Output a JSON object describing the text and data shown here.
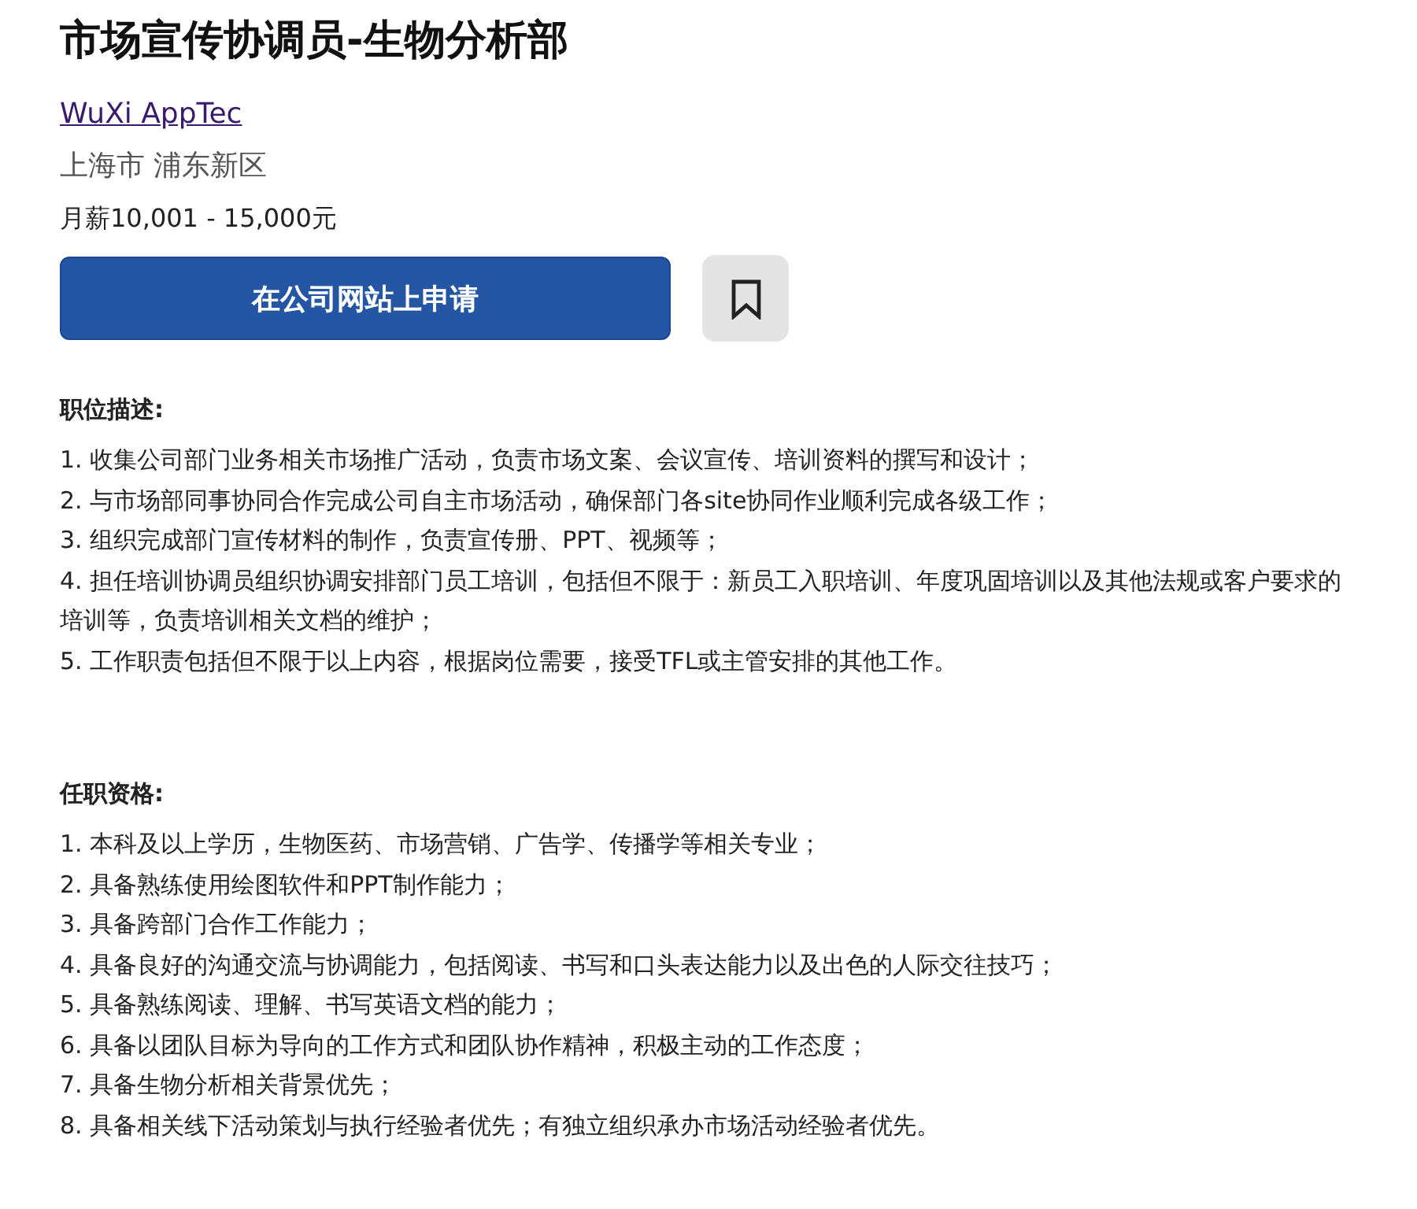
{
  "job": {
    "title": "市场宣传协调员-生物分析部",
    "company": "WuXi AppTec",
    "location": "上海市 浦东新区",
    "salary": "月薪10,001 - 15,000元"
  },
  "actions": {
    "apply": "在公司网站上申请",
    "saved": false
  },
  "sections": [
    {
      "heading": "职位描述:",
      "items": [
        "1. 收集公司部门业务相关市场推广活动，负责市场文案、会议宣传、培训资料的撰写和设计；",
        "2. 与市场部同事协同合作完成公司自主市场活动，确保部门各site协同作业顺利完成各级工作；",
        "3. 组织完成部门宣传材料的制作，负责宣传册、PPT、视频等；",
        "4. 担任培训协调员组织协调安排部门员工培训，包括但不限于：新员工入职培训、年度巩固培训以及其他法规或客户要求的培训等，负责培训相关文档的维护；",
        "5. 工作职责包括但不限于以上内容，根据岗位需要，接受TFL或主管安排的其他工作。"
      ]
    },
    {
      "heading": "任职资格:",
      "items": [
        "1. 本科及以上学历，生物医药、市场营销、广告学、传播学等相关专业；",
        "2. 具备熟练使用绘图软件和PPT制作能力；",
        "3. 具备跨部门合作工作能力；",
        "4. 具备良好的沟通交流与协调能力，包括阅读、书写和口头表达能力以及出色的人际交往技巧；",
        "5. 具备熟练阅读、理解、书写英语文档的能力；",
        "6. 具备以团队目标为导向的工作方式和团队协作精神，积极主动的工作态度；",
        "7. 具备生物分析相关背景优先；",
        "8. 具备相关线下活动策划与执行经验者优先；有独立组织承办市场活动经验者优先。"
      ]
    }
  ]
}
